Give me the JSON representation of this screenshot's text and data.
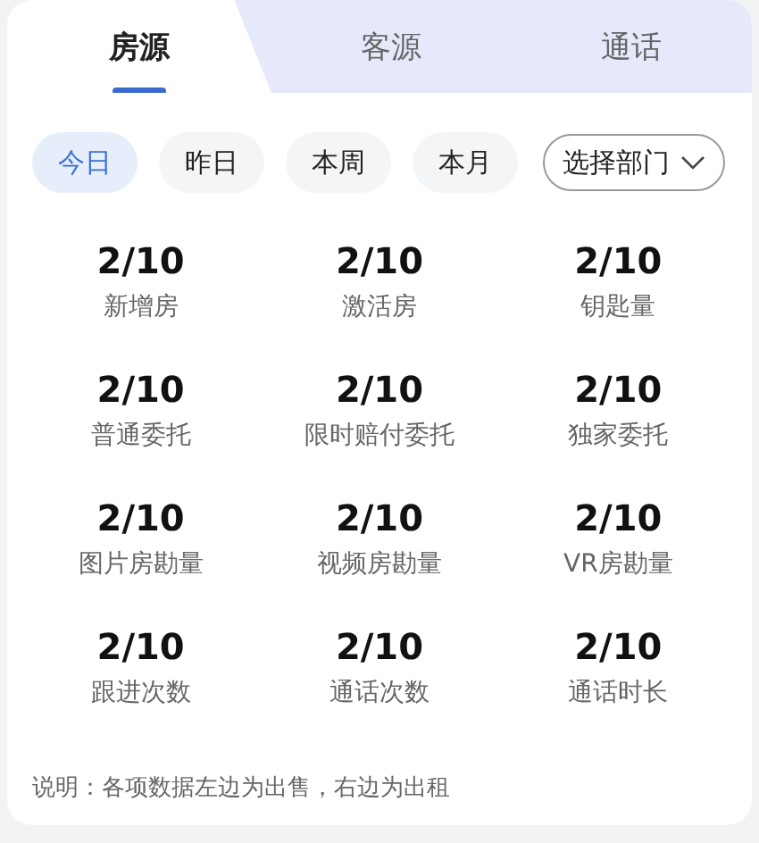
{
  "tabs": [
    {
      "label": "房源",
      "selected": true
    },
    {
      "label": "客源",
      "selected": false
    },
    {
      "label": "通话",
      "selected": false
    }
  ],
  "filters": [
    {
      "label": "今日",
      "selected": true
    },
    {
      "label": "昨日",
      "selected": false
    },
    {
      "label": "本周",
      "selected": false
    },
    {
      "label": "本月",
      "selected": false
    }
  ],
  "department_select": {
    "label": "选择部门"
  },
  "stats": [
    {
      "value": "2/10",
      "label": "新增房"
    },
    {
      "value": "2/10",
      "label": "激活房"
    },
    {
      "value": "2/10",
      "label": "钥匙量"
    },
    {
      "value": "2/10",
      "label": "普通委托"
    },
    {
      "value": "2/10",
      "label": "限时赔付委托"
    },
    {
      "value": "2/10",
      "label": "独家委托"
    },
    {
      "value": "2/10",
      "label": "图片房勘量"
    },
    {
      "value": "2/10",
      "label": "视频房勘量"
    },
    {
      "value": "2/10",
      "label": "VR房勘量"
    },
    {
      "value": "2/10",
      "label": "跟进次数"
    },
    {
      "value": "2/10",
      "label": "通话次数"
    },
    {
      "value": "2/10",
      "label": "通话时长"
    }
  ],
  "note": "说明：各项数据左边为出售，右边为出租"
}
